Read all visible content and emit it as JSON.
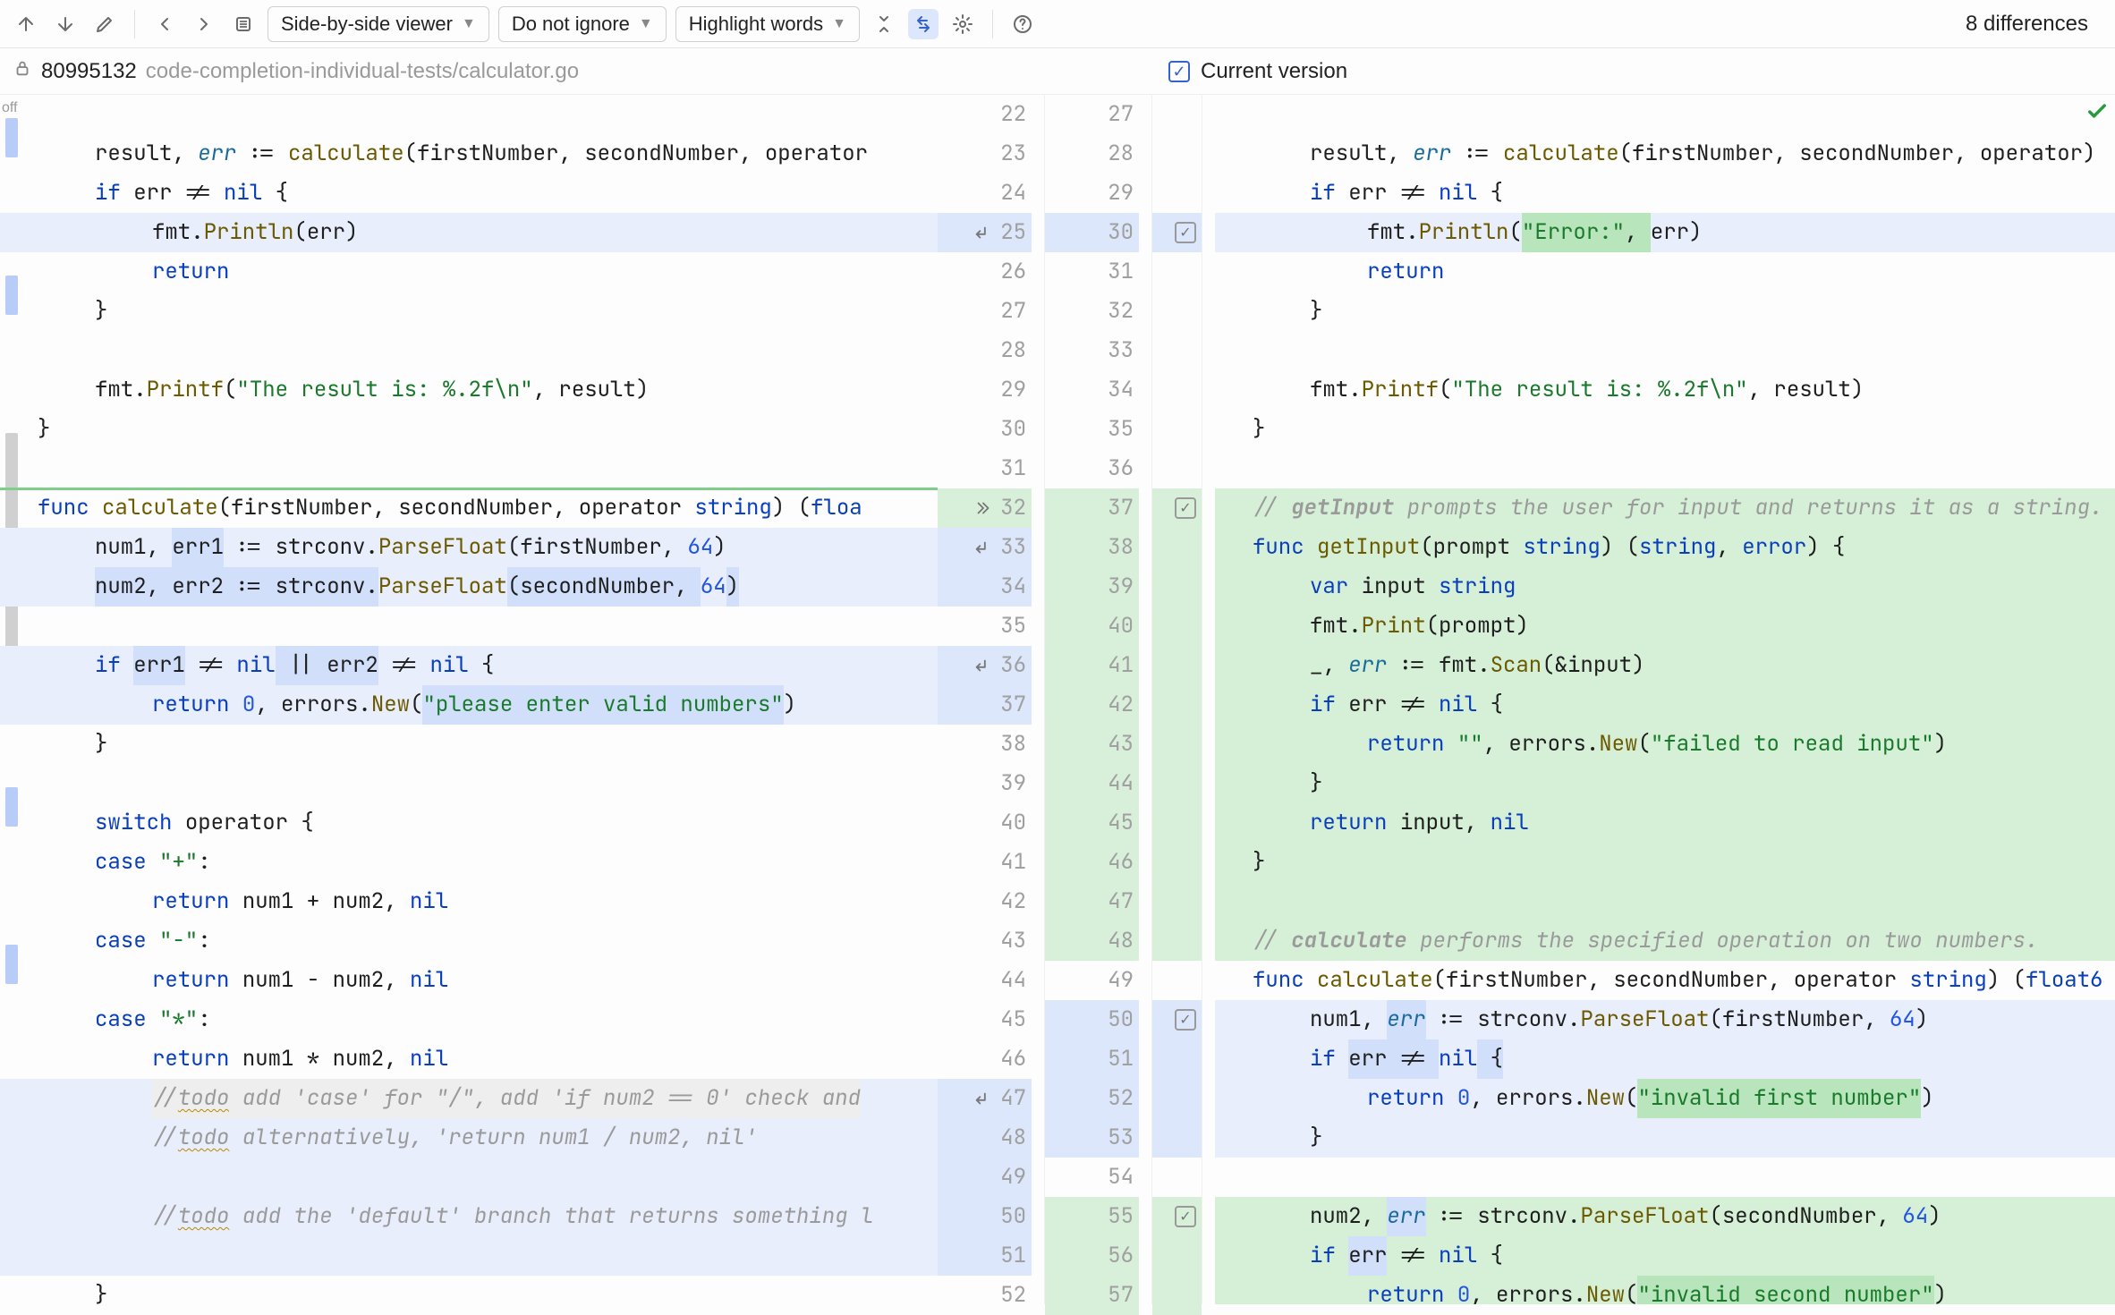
{
  "toolbar": {
    "viewer_mode": "Side-by-side viewer",
    "ignore_mode": "Do not ignore",
    "highlight_mode": "Highlight words",
    "diff_count": "8 differences"
  },
  "file": {
    "revision": "80995132",
    "path": "code-completion-individual-tests/calculator.go",
    "current_label": "Current version",
    "off_label": "off"
  },
  "gutters": {
    "left": [
      "22",
      "23",
      "24",
      "25",
      "26",
      "27",
      "28",
      "29",
      "30",
      "31",
      "32",
      "33",
      "34",
      "35",
      "36",
      "37",
      "38",
      "39",
      "40",
      "41",
      "42",
      "43",
      "44",
      "45",
      "46",
      "47",
      "48",
      "49",
      "50",
      "51",
      "52"
    ],
    "right": [
      "27",
      "28",
      "29",
      "30",
      "31",
      "32",
      "33",
      "34",
      "35",
      "36",
      "37",
      "38",
      "39",
      "40",
      "41",
      "42",
      "43",
      "44",
      "45",
      "46",
      "47",
      "48",
      "49",
      "50",
      "51",
      "52",
      "53",
      "54",
      "55",
      "56",
      "57"
    ]
  },
  "left_code": [
    {
      "cls": "",
      "segs": [
        {
          "t": ""
        }
      ]
    },
    {
      "cls": "ind1",
      "segs": [
        {
          "t": "result, "
        },
        {
          "t": "err",
          "c": "tok-err"
        },
        {
          "t": " := "
        },
        {
          "t": "calculate",
          "c": "tok-fn"
        },
        {
          "t": "(firstNumber, secondNumber, operator"
        }
      ]
    },
    {
      "cls": "ind1",
      "segs": [
        {
          "t": "if ",
          "c": "tok-kw"
        },
        {
          "t": "err != "
        },
        {
          "t": "nil",
          "c": "tok-kw"
        },
        {
          "t": " {"
        }
      ]
    },
    {
      "cls": "ind2 hl-blue",
      "segs": [
        {
          "t": "fmt."
        },
        {
          "t": "Println",
          "c": "tok-fn"
        },
        {
          "t": "(err)"
        }
      ]
    },
    {
      "cls": "ind2",
      "segs": [
        {
          "t": "return",
          "c": "tok-kw"
        }
      ]
    },
    {
      "cls": "ind1",
      "segs": [
        {
          "t": "}"
        }
      ]
    },
    {
      "cls": "",
      "segs": [
        {
          "t": ""
        }
      ]
    },
    {
      "cls": "ind1",
      "segs": [
        {
          "t": "fmt."
        },
        {
          "t": "Printf",
          "c": "tok-fn"
        },
        {
          "t": "("
        },
        {
          "t": "\"The result is: %.2f\\n\"",
          "c": "tok-str"
        },
        {
          "t": ", result)"
        }
      ]
    },
    {
      "cls": "",
      "segs": [
        {
          "t": "}"
        }
      ]
    },
    {
      "cls": "",
      "segs": [
        {
          "t": ""
        }
      ]
    },
    {
      "cls": "",
      "segs": [
        {
          "t": "func ",
          "c": "tok-kw"
        },
        {
          "t": "calculate",
          "c": "tok-fn"
        },
        {
          "t": "(firstNumber, secondNumber, operator "
        },
        {
          "t": "string",
          "c": "tok-ty"
        },
        {
          "t": ") ("
        },
        {
          "t": "floa",
          "c": "tok-ty"
        }
      ]
    },
    {
      "cls": "ind1 hl-blue",
      "segs": [
        {
          "t": "num1, ",
          "c": ""
        },
        {
          "t": "err1",
          "c": "hl-blue2"
        },
        {
          "t": " := strconv."
        },
        {
          "t": "ParseFloat",
          "c": "tok-fn"
        },
        {
          "t": "(firstNumber, "
        },
        {
          "t": "64",
          "c": "tok-num"
        },
        {
          "t": ")"
        }
      ]
    },
    {
      "cls": "ind1 hl-blue",
      "segs": [
        {
          "t": "num2, err2 := strconv.",
          "hl": "hl-blue2"
        },
        {
          "t": "ParseFloat",
          "c": "tok-fn"
        },
        {
          "t": "(secondNumber, ",
          "hl": "hl-blue2"
        },
        {
          "t": "64",
          "c": "tok-num"
        },
        {
          "t": ")",
          "hl": "hl-blue2"
        }
      ]
    },
    {
      "cls": "",
      "segs": [
        {
          "t": ""
        }
      ]
    },
    {
      "cls": "ind1 hl-blue",
      "segs": [
        {
          "t": "if ",
          "c": "tok-kw"
        },
        {
          "t": "err1",
          "hl": "hl-blue2"
        },
        {
          "t": " != "
        },
        {
          "t": "nil",
          "c": "tok-kw"
        },
        {
          "t": " || ",
          "hl": "hl-blue2"
        },
        {
          "t": "err2",
          "hl": "hl-blue2"
        },
        {
          "t": " != "
        },
        {
          "t": "nil",
          "c": "tok-kw"
        },
        {
          "t": " {"
        }
      ]
    },
    {
      "cls": "ind2 hl-blue",
      "segs": [
        {
          "t": "return ",
          "c": "tok-kw"
        },
        {
          "t": "0",
          "c": "tok-num"
        },
        {
          "t": ", errors."
        },
        {
          "t": "New",
          "c": "tok-fn"
        },
        {
          "t": "("
        },
        {
          "t": "\"please enter valid numbers\"",
          "c": "tok-str hl-blue2"
        },
        {
          "t": ")"
        }
      ]
    },
    {
      "cls": "ind1",
      "segs": [
        {
          "t": "}"
        }
      ]
    },
    {
      "cls": "",
      "segs": [
        {
          "t": ""
        }
      ]
    },
    {
      "cls": "ind1",
      "segs": [
        {
          "t": "switch ",
          "c": "tok-kw"
        },
        {
          "t": "operator {"
        }
      ]
    },
    {
      "cls": "ind1",
      "segs": [
        {
          "t": "case ",
          "c": "tok-kw"
        },
        {
          "t": "\"+\"",
          "c": "tok-str"
        },
        {
          "t": ":"
        }
      ]
    },
    {
      "cls": "ind2",
      "segs": [
        {
          "t": "return ",
          "c": "tok-kw"
        },
        {
          "t": "num1 + num2, "
        },
        {
          "t": "nil",
          "c": "tok-kw"
        }
      ]
    },
    {
      "cls": "ind1",
      "segs": [
        {
          "t": "case ",
          "c": "tok-kw"
        },
        {
          "t": "\"-\"",
          "c": "tok-str"
        },
        {
          "t": ":"
        }
      ]
    },
    {
      "cls": "ind2",
      "segs": [
        {
          "t": "return ",
          "c": "tok-kw"
        },
        {
          "t": "num1 - num2, "
        },
        {
          "t": "nil",
          "c": "tok-kw"
        }
      ]
    },
    {
      "cls": "ind1",
      "segs": [
        {
          "t": "case ",
          "c": "tok-kw"
        },
        {
          "t": "\"*\"",
          "c": "tok-str"
        },
        {
          "t": ":"
        }
      ]
    },
    {
      "cls": "ind2",
      "segs": [
        {
          "t": "return ",
          "c": "tok-kw"
        },
        {
          "t": "num1 * num2, "
        },
        {
          "t": "nil",
          "c": "tok-kw"
        }
      ]
    },
    {
      "cls": "ind2 hl-blue",
      "segs": [
        {
          "t": "//",
          "c": "tok-com hl-gray"
        },
        {
          "t": "todo",
          "c": "tok-com wavy hl-gray"
        },
        {
          "t": " add 'case' for \"/\", add 'if num2 == 0' check and",
          "c": "tok-com hl-gray"
        }
      ]
    },
    {
      "cls": "ind2 hl-blue",
      "segs": [
        {
          "t": "//",
          "c": "tok-com"
        },
        {
          "t": "todo",
          "c": "tok-com wavy"
        },
        {
          "t": " alternatively, 'return num1 / num2, nil'",
          "c": "tok-com"
        }
      ]
    },
    {
      "cls": "hl-blue",
      "segs": [
        {
          "t": ""
        }
      ]
    },
    {
      "cls": "ind2 hl-blue",
      "segs": [
        {
          "t": "//",
          "c": "tok-com"
        },
        {
          "t": "todo",
          "c": "tok-com wavy"
        },
        {
          "t": " add the 'default' branch that returns something l",
          "c": "tok-com"
        }
      ]
    },
    {
      "cls": "hl-blue",
      "segs": [
        {
          "t": ""
        }
      ]
    },
    {
      "cls": "ind1",
      "segs": [
        {
          "t": "}"
        }
      ]
    }
  ],
  "right_code": [
    {
      "cls": "",
      "segs": [
        {
          "t": ""
        }
      ]
    },
    {
      "cls": "ind1",
      "segs": [
        {
          "t": "result, "
        },
        {
          "t": "err",
          "c": "tok-err"
        },
        {
          "t": " := "
        },
        {
          "t": "calculate",
          "c": "tok-fn"
        },
        {
          "t": "(firstNumber, secondNumber, operator)"
        }
      ]
    },
    {
      "cls": "ind1",
      "segs": [
        {
          "t": "if ",
          "c": "tok-kw"
        },
        {
          "t": "err != "
        },
        {
          "t": "nil",
          "c": "tok-kw"
        },
        {
          "t": " {"
        }
      ]
    },
    {
      "cls": "ind2 hl-blue",
      "segs": [
        {
          "t": "fmt."
        },
        {
          "t": "Println",
          "c": "tok-fn"
        },
        {
          "t": "("
        },
        {
          "t": "\"Error:\"",
          "c": "tok-str hl-green2"
        },
        {
          "t": ", ",
          "hl": "hl-green2"
        },
        {
          "t": "err)"
        }
      ]
    },
    {
      "cls": "ind2",
      "segs": [
        {
          "t": "return",
          "c": "tok-kw"
        }
      ]
    },
    {
      "cls": "ind1",
      "segs": [
        {
          "t": "}"
        }
      ]
    },
    {
      "cls": "",
      "segs": [
        {
          "t": ""
        }
      ]
    },
    {
      "cls": "ind1",
      "segs": [
        {
          "t": "fmt."
        },
        {
          "t": "Printf",
          "c": "tok-fn"
        },
        {
          "t": "("
        },
        {
          "t": "\"The result is: %.2f\\n\"",
          "c": "tok-str"
        },
        {
          "t": ", result)"
        }
      ]
    },
    {
      "cls": "",
      "segs": [
        {
          "t": "}"
        }
      ]
    },
    {
      "cls": "",
      "segs": [
        {
          "t": ""
        }
      ]
    },
    {
      "cls": "hl-green",
      "segs": [
        {
          "t": "// ",
          "c": "tok-com"
        },
        {
          "t": "getInput",
          "c": "tok-com2"
        },
        {
          "t": " prompts the user for input and returns it as a string.",
          "c": "tok-com"
        }
      ]
    },
    {
      "cls": "hl-green",
      "segs": [
        {
          "t": "func ",
          "c": "tok-kw"
        },
        {
          "t": "getInput",
          "c": "tok-fn"
        },
        {
          "t": "(prompt "
        },
        {
          "t": "string",
          "c": "tok-ty"
        },
        {
          "t": ") ("
        },
        {
          "t": "string",
          "c": "tok-ty"
        },
        {
          "t": ", "
        },
        {
          "t": "error",
          "c": "tok-ty"
        },
        {
          "t": ") {"
        }
      ]
    },
    {
      "cls": "ind1 hl-green",
      "segs": [
        {
          "t": "var ",
          "c": "tok-kw"
        },
        {
          "t": "input "
        },
        {
          "t": "string",
          "c": "tok-ty"
        }
      ]
    },
    {
      "cls": "ind1 hl-green",
      "segs": [
        {
          "t": "fmt."
        },
        {
          "t": "Print",
          "c": "tok-fn"
        },
        {
          "t": "(prompt)"
        }
      ]
    },
    {
      "cls": "ind1 hl-green",
      "segs": [
        {
          "t": "_, "
        },
        {
          "t": "err",
          "c": "tok-err"
        },
        {
          "t": " := fmt."
        },
        {
          "t": "Scan",
          "c": "tok-fn"
        },
        {
          "t": "(&input)"
        }
      ]
    },
    {
      "cls": "ind1 hl-green",
      "segs": [
        {
          "t": "if ",
          "c": "tok-kw"
        },
        {
          "t": "err != "
        },
        {
          "t": "nil",
          "c": "tok-kw"
        },
        {
          "t": " {"
        }
      ]
    },
    {
      "cls": "ind2 hl-green",
      "segs": [
        {
          "t": "return ",
          "c": "tok-kw"
        },
        {
          "t": "\"\"",
          "c": "tok-str"
        },
        {
          "t": ", errors."
        },
        {
          "t": "New",
          "c": "tok-fn"
        },
        {
          "t": "("
        },
        {
          "t": "\"failed to read input\"",
          "c": "tok-str"
        },
        {
          "t": ")"
        }
      ]
    },
    {
      "cls": "ind1 hl-green",
      "segs": [
        {
          "t": "}"
        }
      ]
    },
    {
      "cls": "ind1 hl-green",
      "segs": [
        {
          "t": "return ",
          "c": "tok-kw"
        },
        {
          "t": "input, "
        },
        {
          "t": "nil",
          "c": "tok-kw"
        }
      ]
    },
    {
      "cls": "hl-green",
      "segs": [
        {
          "t": "}"
        }
      ]
    },
    {
      "cls": "hl-green",
      "segs": [
        {
          "t": ""
        }
      ]
    },
    {
      "cls": "hl-green",
      "segs": [
        {
          "t": "// ",
          "c": "tok-com"
        },
        {
          "t": "calculate",
          "c": "tok-com2"
        },
        {
          "t": " performs the specified operation on two numbers.",
          "c": "tok-com"
        }
      ]
    },
    {
      "cls": "",
      "segs": [
        {
          "t": "func ",
          "c": "tok-kw"
        },
        {
          "t": "calculate",
          "c": "tok-fn"
        },
        {
          "t": "(firstNumber, secondNumber, operator "
        },
        {
          "t": "string",
          "c": "tok-ty"
        },
        {
          "t": ") ("
        },
        {
          "t": "float6",
          "c": "tok-ty"
        }
      ]
    },
    {
      "cls": "ind1 hl-blue",
      "segs": [
        {
          "t": "num1, "
        },
        {
          "t": "err",
          "c": "tok-err hl-blue2"
        },
        {
          "t": " := strconv."
        },
        {
          "t": "ParseFloat",
          "c": "tok-fn"
        },
        {
          "t": "(firstNumber, "
        },
        {
          "t": "64",
          "c": "tok-num"
        },
        {
          "t": ")"
        }
      ]
    },
    {
      "cls": "ind1 hl-blue",
      "segs": [
        {
          "t": "if ",
          "c": "tok-kw"
        },
        {
          "t": "err != ",
          "hl": "hl-blue2"
        },
        {
          "t": "nil",
          "c": "tok-kw"
        },
        {
          "t": " {",
          "hl": "hl-blue2"
        }
      ]
    },
    {
      "cls": "ind2 hl-blue",
      "segs": [
        {
          "t": "return ",
          "c": "tok-kw"
        },
        {
          "t": "0",
          "c": "tok-num"
        },
        {
          "t": ", errors."
        },
        {
          "t": "New",
          "c": "tok-fn"
        },
        {
          "t": "("
        },
        {
          "t": "\"invalid first number\"",
          "c": "tok-str hl-green2"
        },
        {
          "t": ")"
        }
      ]
    },
    {
      "cls": "ind1 hl-blue",
      "segs": [
        {
          "t": "}"
        }
      ]
    },
    {
      "cls": "",
      "segs": [
        {
          "t": ""
        }
      ]
    },
    {
      "cls": "ind1 hl-green",
      "segs": [
        {
          "t": "num2, "
        },
        {
          "t": "err",
          "c": "tok-err hl-blue2"
        },
        {
          "t": " := strconv."
        },
        {
          "t": "ParseFloat",
          "c": "tok-fn"
        },
        {
          "t": "(secondNumber, "
        },
        {
          "t": "64",
          "c": "tok-num"
        },
        {
          "t": ")"
        }
      ]
    },
    {
      "cls": "ind1 hl-green",
      "segs": [
        {
          "t": "if ",
          "c": "tok-kw"
        },
        {
          "t": "err",
          "hl": "hl-blue2"
        },
        {
          "t": " != "
        },
        {
          "t": "nil",
          "c": "tok-kw"
        },
        {
          "t": " {"
        }
      ]
    },
    {
      "cls": "ind2 hl-green",
      "segs": [
        {
          "t": "return ",
          "c": "tok-kw"
        },
        {
          "t": "0",
          "c": "tok-num"
        },
        {
          "t": ", errors."
        },
        {
          "t": "New",
          "c": "tok-fn"
        },
        {
          "t": "("
        },
        {
          "t": "\"invalid second number\"",
          "c": "tok-str hl-green2"
        },
        {
          "t": ")"
        }
      ]
    }
  ]
}
